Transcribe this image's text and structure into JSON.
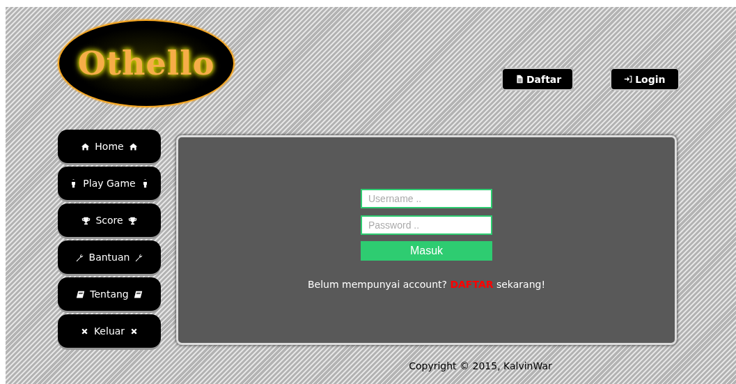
{
  "logo": {
    "text": "Othello"
  },
  "header_buttons": [
    {
      "label": "Daftar"
    },
    {
      "label": "Login"
    }
  ],
  "nav": [
    {
      "label": "Home"
    },
    {
      "label": "Play Game"
    },
    {
      "label": "Score"
    },
    {
      "label": "Bantuan"
    },
    {
      "label": "Tentang"
    },
    {
      "label": "Keluar"
    }
  ],
  "login_form": {
    "username": {
      "placeholder": "Username .."
    },
    "password": {
      "placeholder": "Password .."
    },
    "submit": "Masuk",
    "register_prompt": {
      "before": "Belum mempunyai account?",
      "link": "DAFTAR",
      "after": "sekarang!"
    }
  },
  "footer": "Copyright © 2015, KalvinWar"
}
